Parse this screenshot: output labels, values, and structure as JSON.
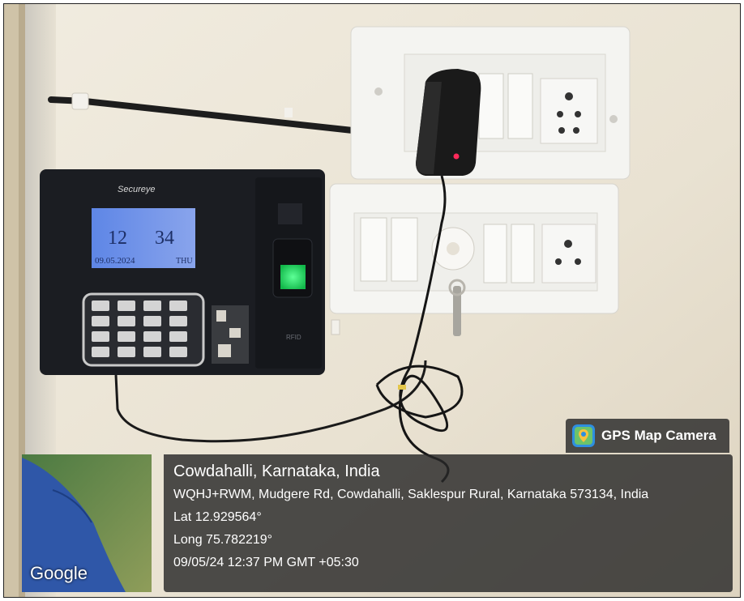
{
  "photo": {
    "description_icons": [
      "fingerprint-scanner-icon",
      "power-adapter-icon",
      "key-icon"
    ],
    "device_brand": "Secureye",
    "lcd_left_number": "12",
    "lcd_right_number": "34",
    "lcd_date": "09.05.2024",
    "lcd_day": "THU",
    "rfid_label": "RFID"
  },
  "overlay": {
    "app_name": "GPS Map Camera",
    "map_brand": "Google",
    "place": "Cowdahalli, Karnataka, India",
    "address": "WQHJ+RWM, Mudgere Rd, Cowdahalli, Saklespur Rural, Karnataka 573134, India",
    "lat": "Lat 12.929564°",
    "long": "Long 75.782219°",
    "datetime": "09/05/24 12:37 PM GMT +05:30"
  },
  "colors": {
    "wall": "#ece5d6",
    "device_body": "#1b1d22",
    "lcd": "#6f8fe6",
    "scanner_light": "#27e36a",
    "overlay_bg": "#282828"
  }
}
